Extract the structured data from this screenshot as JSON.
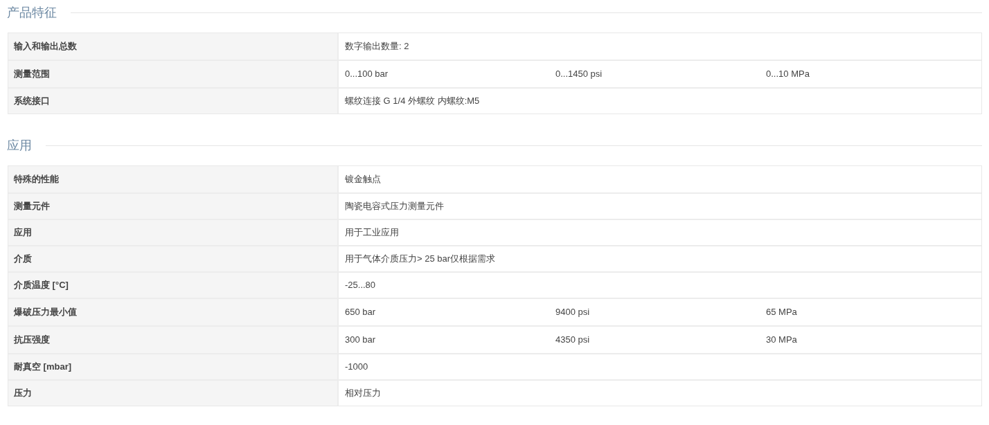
{
  "sections": [
    {
      "title": "产品特征",
      "rows": [
        {
          "label": "输入和输出总数",
          "values": [
            "数字输出数量: 2"
          ]
        },
        {
          "label": "测量范围",
          "values": [
            "0...100 bar",
            "0...1450 psi",
            "0...10 MPa"
          ]
        },
        {
          "label": "系统接口",
          "values": [
            "螺纹连接 G 1/4 外螺纹 内螺纹:M5"
          ]
        }
      ]
    },
    {
      "title": "应用",
      "rows": [
        {
          "label": "特殊的性能",
          "values": [
            "镀金触点"
          ]
        },
        {
          "label": "测量元件",
          "values": [
            "陶瓷电容式压力测量元件"
          ]
        },
        {
          "label": "应用",
          "values": [
            "用于工业应用"
          ]
        },
        {
          "label": "介质",
          "values": [
            "用于气体介质压力> 25 bar仅根据需求"
          ]
        },
        {
          "label": "介质温度 [°C]",
          "values": [
            "-25...80"
          ]
        },
        {
          "label": "爆破压力最小值",
          "values": [
            "650 bar",
            "9400 psi",
            "65 MPa"
          ]
        },
        {
          "label": "抗压强度",
          "values": [
            "300 bar",
            "4350 psi",
            "30 MPa"
          ]
        },
        {
          "label": "耐真空 [mbar]",
          "values": [
            "-1000"
          ]
        },
        {
          "label": "压力",
          "values": [
            "相对压力"
          ]
        }
      ]
    }
  ]
}
